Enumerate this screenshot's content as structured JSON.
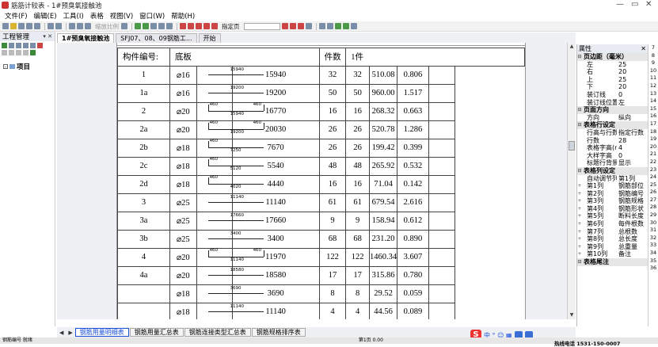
{
  "window": {
    "title": "筋筋计较表 - 1#预臭氧接触池",
    "controls": [
      "—",
      "▭",
      "✕"
    ]
  },
  "menu": [
    "文件(F)",
    "编辑(E)",
    "工具(I)",
    "表格",
    "视图(V)",
    "窗口(W)",
    "帮助(H)"
  ],
  "toolbar": {
    "zoom_label": "缩放比例",
    "page_label": "指定页"
  },
  "left_panel": {
    "title": "工程管理",
    "pin": "▾ ✕",
    "tree_root": "项目",
    "expand": "-"
  },
  "doc_tabs": [
    "1#预臭氧接触池",
    "SFJ07、08、09钢筋工...",
    "开始"
  ],
  "sheet": {
    "component_label": "构件编号:",
    "component_value": "底板",
    "count_label": "件数",
    "count_value": "1件",
    "rows": [
      {
        "no": "1",
        "spec": "⌀16",
        "shape": "straight",
        "dim": "15940",
        "len": "15940",
        "n1": "32",
        "n2": "32",
        "total": "510.08",
        "weight": "0.806"
      },
      {
        "no": "1a",
        "spec": "⌀16",
        "shape": "straight",
        "dim": "19200",
        "len": "19200",
        "n1": "50",
        "n2": "50",
        "total": "960.00",
        "weight": "1.517"
      },
      {
        "no": "2",
        "spec": "⌀20",
        "shape": "hook2",
        "dim": "15940",
        "hook": "460",
        "len": "16770",
        "n1": "16",
        "n2": "16",
        "total": "268.32",
        "weight": "0.663"
      },
      {
        "no": "2a",
        "spec": "⌀20",
        "shape": "hook2",
        "dim": "19200",
        "hook": "460",
        "len": "20030",
        "n1": "26",
        "n2": "26",
        "total": "520.78",
        "weight": "1.286"
      },
      {
        "no": "2b",
        "spec": "⌀18",
        "shape": "hook1",
        "dim": "7250",
        "hook": "460",
        "len": "7670",
        "n1": "26",
        "n2": "26",
        "total": "199.42",
        "weight": "0.399"
      },
      {
        "no": "2c",
        "spec": "⌀18",
        "shape": "hook1",
        "dim": "5120",
        "hook": "460",
        "len": "5540",
        "n1": "48",
        "n2": "48",
        "total": "265.92",
        "weight": "0.532"
      },
      {
        "no": "2d",
        "spec": "⌀18",
        "shape": "hook1",
        "dim": "4020",
        "hook": "460",
        "len": "4440",
        "n1": "16",
        "n2": "16",
        "total": "71.04",
        "weight": "0.142"
      },
      {
        "no": "3",
        "spec": "⌀25",
        "shape": "straight",
        "dim": "11140",
        "len": "11140",
        "n1": "61",
        "n2": "61",
        "total": "679.54",
        "weight": "2.616"
      },
      {
        "no": "3a",
        "spec": "⌀25",
        "shape": "straight",
        "dim": "17660",
        "len": "17660",
        "n1": "9",
        "n2": "9",
        "total": "158.94",
        "weight": "0.612"
      },
      {
        "no": "3b",
        "spec": "⌀25",
        "shape": "straight",
        "dim": "3400",
        "len": "3400",
        "n1": "68",
        "n2": "68",
        "total": "231.20",
        "weight": "0.890"
      },
      {
        "no": "4",
        "spec": "⌀20",
        "shape": "hook2",
        "dim": "11140",
        "hook": "460",
        "len": "11970",
        "n1": "122",
        "n2": "122",
        "total": "1460.34",
        "weight": "3.607"
      },
      {
        "no": "4a",
        "spec": "⌀20",
        "shape": "straight",
        "dim": "18580",
        "len": "18580",
        "n1": "17",
        "n2": "17",
        "total": "315.86",
        "weight": "0.780"
      },
      {
        "no": "",
        "spec": "⌀18",
        "shape": "straight",
        "dim": "3690",
        "len": "3690",
        "n1": "8",
        "n2": "8",
        "total": "29.52",
        "weight": "0.059"
      },
      {
        "no": "",
        "spec": "⌀18",
        "shape": "straight",
        "dim": "11140",
        "len": "11140",
        "n1": "4",
        "n2": "4",
        "total": "44.56",
        "weight": "0.089"
      }
    ]
  },
  "sheet_tabs": [
    "钢筋用量明细表",
    "钢筋用量汇总表",
    "钢筋连接类型汇总表",
    "钢筋规格排序表"
  ],
  "props": {
    "title": "属性",
    "rows": [
      {
        "t": "sec",
        "k": "页边距（毫米）"
      },
      {
        "k": "左",
        "v": "25"
      },
      {
        "k": "右",
        "v": "20"
      },
      {
        "k": "上",
        "v": "25"
      },
      {
        "k": "下",
        "v": "20"
      },
      {
        "k": "装订线",
        "v": "0"
      },
      {
        "k": "装订线位置",
        "v": "左"
      },
      {
        "t": "sec",
        "k": "页面方向"
      },
      {
        "k": "方向",
        "v": "纵向"
      },
      {
        "t": "sec",
        "k": "表格行设定"
      },
      {
        "k": "行高与行数",
        "v": "指定行数"
      },
      {
        "k": "行数",
        "v": "28"
      },
      {
        "k": "表格字高(n",
        "v": "4"
      },
      {
        "k": "大样字高",
        "v": "0"
      },
      {
        "k": "标题行背景",
        "v": "显示"
      },
      {
        "t": "sec",
        "k": "表格列设定"
      },
      {
        "k": "自动调节列",
        "v": "第1列"
      },
      {
        "g": "+",
        "k": "第1列",
        "v": "钢筋部位"
      },
      {
        "g": "+",
        "k": "第2列",
        "v": "钢筋编号"
      },
      {
        "g": "+",
        "k": "第3列",
        "v": "钢筋规格"
      },
      {
        "g": "+",
        "k": "第4列",
        "v": "钢筋形状"
      },
      {
        "g": "+",
        "k": "第5列",
        "v": "断料长度"
      },
      {
        "g": "+",
        "k": "第6列",
        "v": "每件根数"
      },
      {
        "g": "+",
        "k": "第7列",
        "v": "总根数"
      },
      {
        "g": "+",
        "k": "第8列",
        "v": "总长度"
      },
      {
        "g": "+",
        "k": "第9列",
        "v": "总重量"
      },
      {
        "g": "+",
        "k": "第10列",
        "v": "备注"
      },
      {
        "t": "sec",
        "k": "表格尾注"
      }
    ]
  },
  "ruler": [
    "7",
    "8",
    "9",
    "10",
    "11",
    "12",
    "13",
    "14",
    "15",
    "16",
    "17",
    "18",
    "19",
    "20",
    "21",
    "22",
    "23",
    "24",
    "25",
    "26",
    "27",
    "28",
    "29",
    "30",
    "31",
    "32",
    "33",
    "34",
    "35",
    "36"
  ],
  "statusbar": {
    "left": "钢筋编号  就绪",
    "page": "第1页  0.00",
    "hotline": "热线电话 1531-150-0007"
  },
  "ime": {
    "logo": "S",
    "text": "中 ° ☺ ▦"
  }
}
